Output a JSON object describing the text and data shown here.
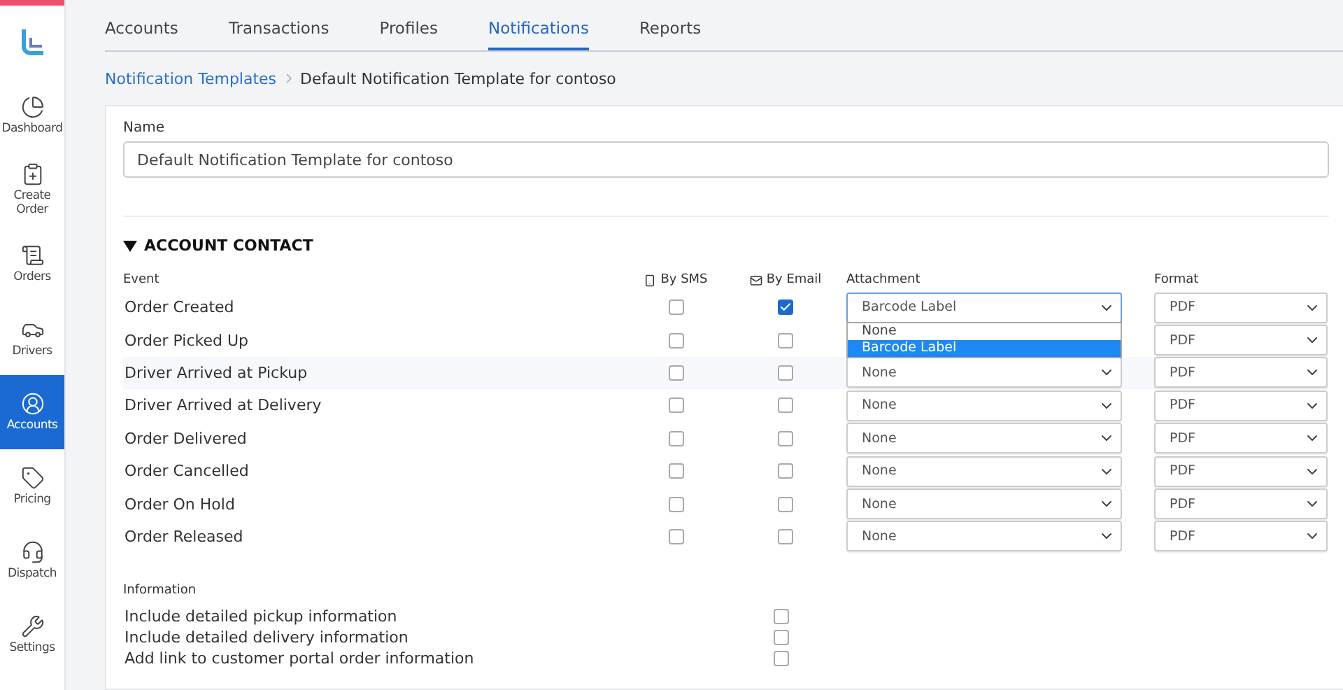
{
  "sidebar": {
    "items": [
      {
        "label": "Dashboard",
        "selected": false
      },
      {
        "label": "Create Order",
        "selected": false
      },
      {
        "label": "Orders",
        "selected": false
      },
      {
        "label": "Drivers",
        "selected": false
      },
      {
        "label": "Accounts",
        "selected": true
      },
      {
        "label": "Pricing",
        "selected": false
      },
      {
        "label": "Dispatch",
        "selected": false
      },
      {
        "label": "Settings",
        "selected": false
      }
    ]
  },
  "tabs": [
    {
      "label": "Accounts",
      "selected": false
    },
    {
      "label": "Transactions",
      "selected": false
    },
    {
      "label": "Profiles",
      "selected": false
    },
    {
      "label": "Notifications",
      "selected": true
    },
    {
      "label": "Reports",
      "selected": false
    }
  ],
  "breadcrumb": {
    "link": "Notification Templates",
    "current": "Default Notification Template for contoso"
  },
  "name_field": {
    "label": "Name",
    "value": "Default Notification Template for contoso"
  },
  "section": {
    "title": "ACCOUNT CONTACT",
    "expanded": true,
    "columns": {
      "event": "Event",
      "sms": "By SMS",
      "email": "By Email",
      "attachment": "Attachment",
      "format": "Format"
    },
    "rows": [
      {
        "event": "Order Created",
        "sms": false,
        "email": true,
        "attachment": "Barcode Label",
        "format": "PDF",
        "highlighted": false,
        "open": true,
        "options": [
          {
            "label": "None",
            "selected": false
          },
          {
            "label": "Barcode Label",
            "selected": true
          }
        ]
      },
      {
        "event": "Order Picked Up",
        "sms": false,
        "email": false,
        "format": "PDF",
        "highlighted": false,
        "open": false
      },
      {
        "event": "Driver Arrived at Pickup",
        "sms": false,
        "email": false,
        "attachment": "None",
        "format": "PDF",
        "highlighted": true,
        "open": false
      },
      {
        "event": "Driver Arrived at Delivery",
        "sms": false,
        "email": false,
        "attachment": "None",
        "format": "PDF",
        "highlighted": false,
        "open": false
      },
      {
        "event": "Order Delivered",
        "sms": false,
        "email": false,
        "attachment": "None",
        "format": "PDF",
        "highlighted": false,
        "open": false
      },
      {
        "event": "Order Cancelled",
        "sms": false,
        "email": false,
        "attachment": "None",
        "format": "PDF",
        "highlighted": false,
        "open": false
      },
      {
        "event": "Order On Hold",
        "sms": false,
        "email": false,
        "attachment": "None",
        "format": "PDF",
        "highlighted": false,
        "open": false
      },
      {
        "event": "Order Released",
        "sms": false,
        "email": false,
        "attachment": "None",
        "format": "PDF",
        "highlighted": false,
        "open": false
      }
    ]
  },
  "information": {
    "label": "Information",
    "items": [
      {
        "label": "Include detailed pickup information",
        "checked": false
      },
      {
        "label": "Include detailed delivery information",
        "checked": false
      },
      {
        "label": "Add link to customer portal order information",
        "checked": false
      }
    ]
  }
}
